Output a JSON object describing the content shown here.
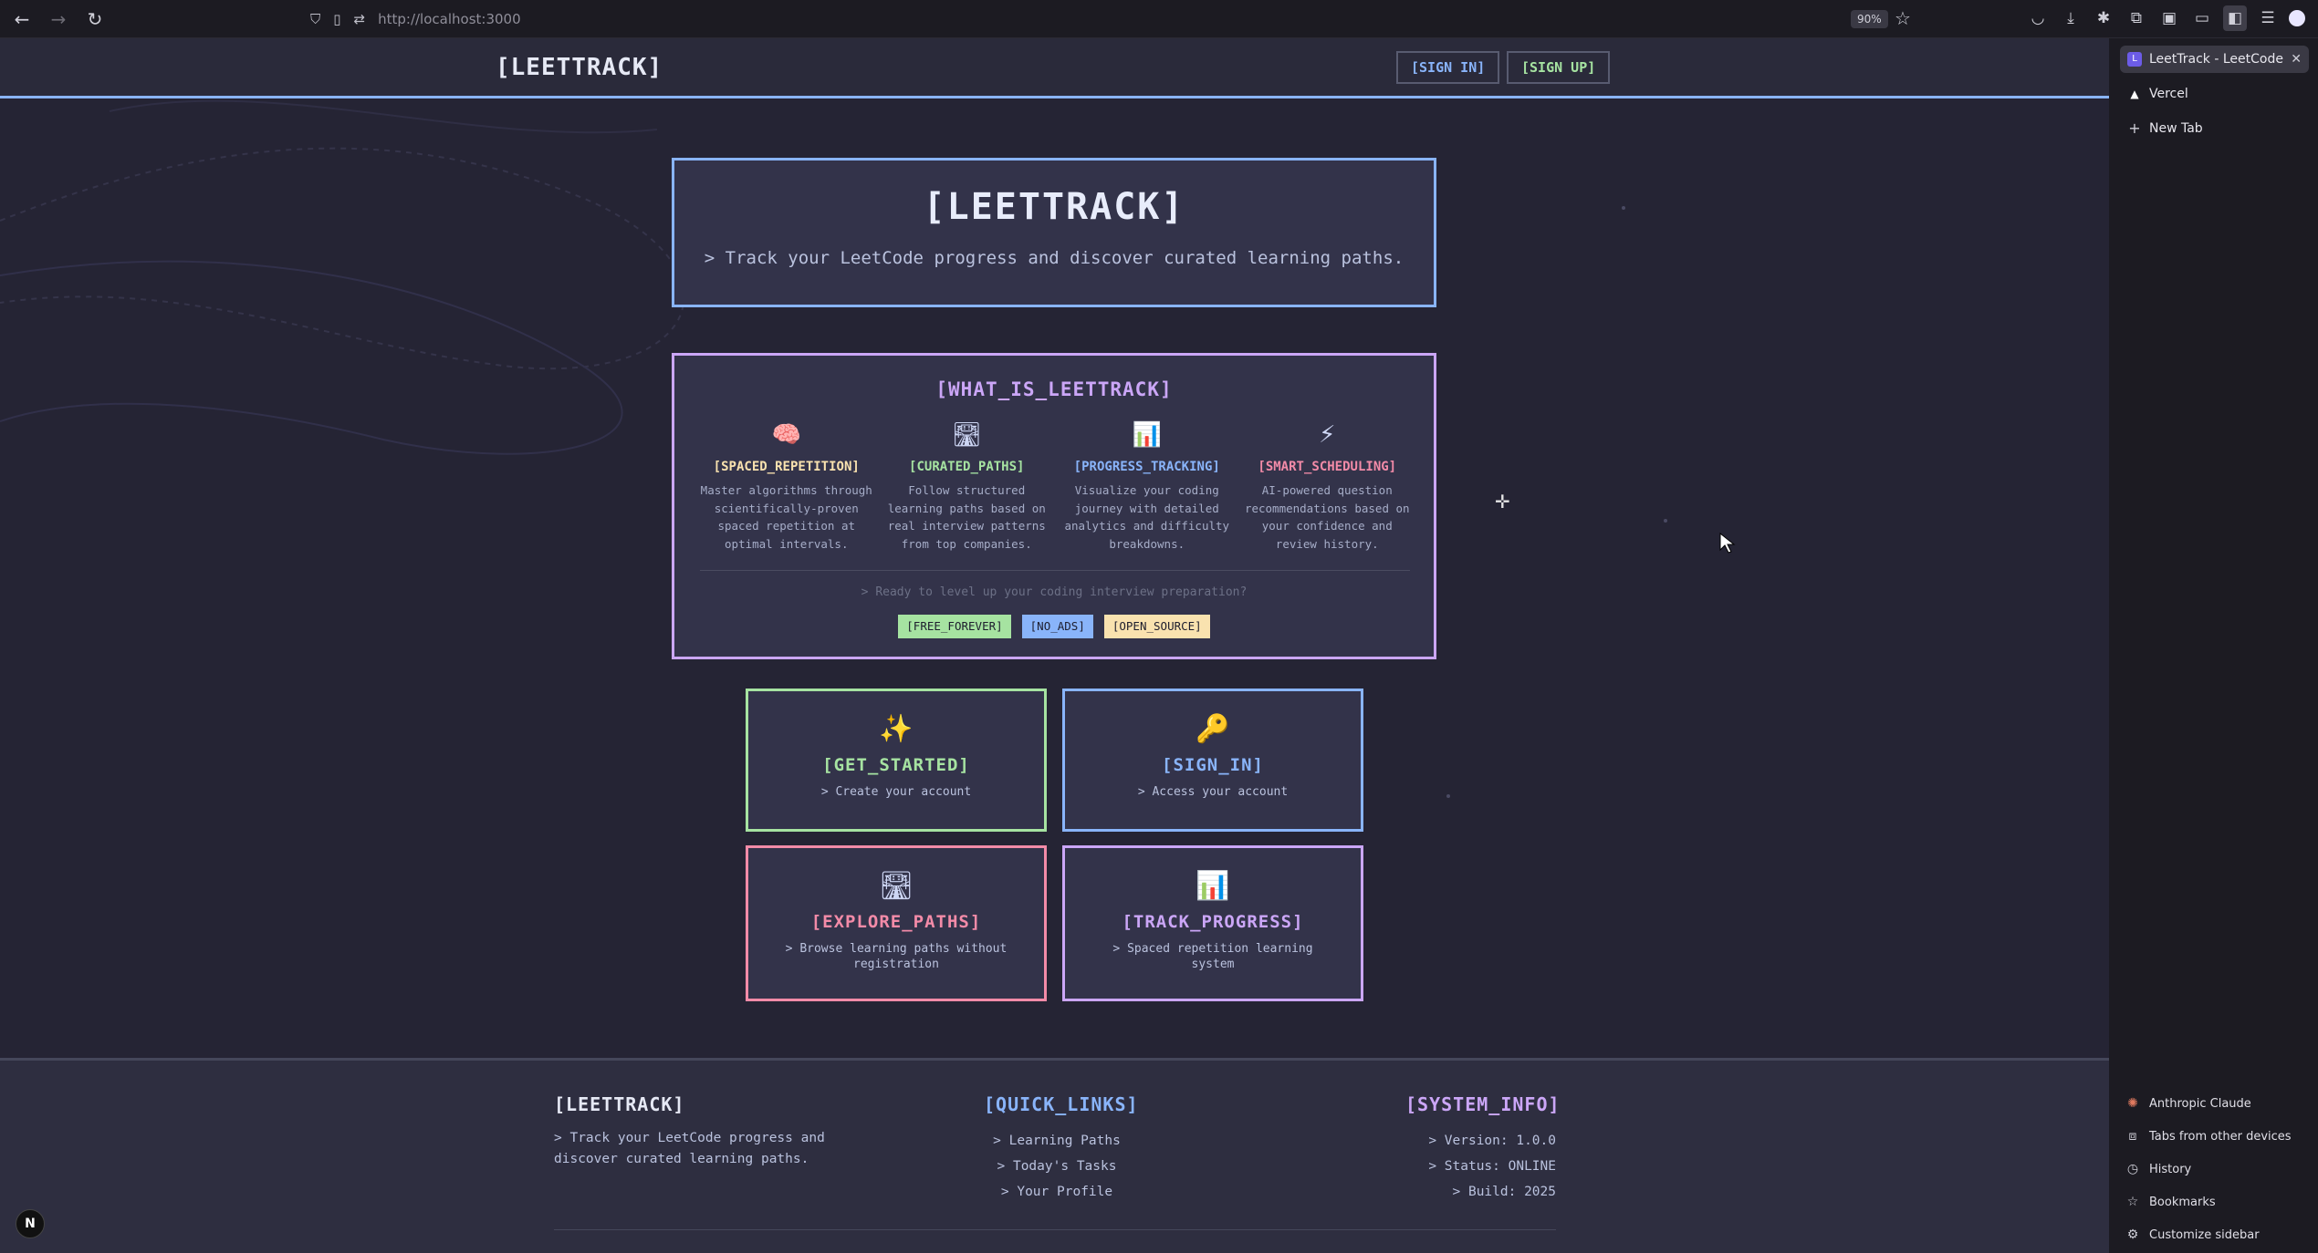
{
  "browser": {
    "url": "http://localhost:3000",
    "zoom": "90%",
    "icons": {
      "back": "back-arrow-icon",
      "forward": "forward-arrow-icon",
      "reload": "reload-icon",
      "bookmark": "star-icon"
    }
  },
  "sidebar": {
    "tabs": [
      {
        "label": "LeetTrack - LeetCode Le",
        "active": true
      },
      {
        "label": "Vercel",
        "active": false
      },
      {
        "label": "New Tab",
        "active": false
      }
    ],
    "bottom_items": [
      {
        "label": "Anthropic Claude",
        "icon": "claude-icon"
      },
      {
        "label": "Tabs from other devices",
        "icon": "devices-icon"
      },
      {
        "label": "History",
        "icon": "history-icon"
      },
      {
        "label": "Bookmarks",
        "icon": "star-icon"
      },
      {
        "label": "Customize sidebar",
        "icon": "gear-icon"
      }
    ]
  },
  "header": {
    "logo": "[LEETTRACK]",
    "sign_in": "[SIGN IN]",
    "sign_up": "[SIGN UP]"
  },
  "hero": {
    "title": "[LEETTRACK]",
    "subtitle": "> Track your LeetCode progress and discover curated learning paths."
  },
  "about": {
    "title": "[WHAT_IS_LEETTRACK]",
    "features": [
      {
        "icon": "🧠",
        "title": "[SPACED_REPETITION]",
        "description": "Master algorithms through scientifically-proven spaced repetition at optimal intervals."
      },
      {
        "icon": "🛣",
        "title": "[CURATED_PATHS]",
        "description": "Follow structured learning paths based on real interview patterns from top companies."
      },
      {
        "icon": "📊",
        "title": "[PROGRESS_TRACKING]",
        "description": "Visualize your coding journey with detailed analytics and difficulty breakdowns."
      },
      {
        "icon": "⚡",
        "title": "[SMART_SCHEDULING]",
        "description": "AI-powered question recommendations based on your confidence and review history."
      }
    ],
    "cta": "> Ready to level up your coding interview preparation?",
    "badges": [
      "[FREE_FOREVER]",
      "[NO_ADS]",
      "[OPEN_SOURCE]"
    ]
  },
  "cards": {
    "get_started": {
      "icon": "✨",
      "title": "[GET_STARTED]",
      "subtitle": "> Create your account"
    },
    "sign_in": {
      "icon": "🔑",
      "title": "[SIGN_IN]",
      "subtitle": "> Access your account"
    },
    "explore": {
      "icon": "🛣",
      "title": "[EXPLORE_PATHS]",
      "subtitle": "> Browse learning paths without registration"
    },
    "track": {
      "icon": "📊",
      "title": "[TRACK_PROGRESS]",
      "subtitle": "> Spaced repetition learning system"
    }
  },
  "footer": {
    "brand": "[LEETTRACK]",
    "brand_text": "> Track your LeetCode progress and discover curated learning paths.",
    "links_title": "[QUICK_LINKS]",
    "links": [
      "> Learning Paths",
      "> Today's Tasks",
      "> Your Profile"
    ],
    "system_title": "[SYSTEM_INFO]",
    "system": [
      "> Version: 1.0.0",
      "> Status: ONLINE",
      "> Build: 2025"
    ]
  },
  "next_badge": "N",
  "colors": {
    "blue": "#89b4fa",
    "purple": "#cba6f7",
    "green": "#a6e3a1",
    "pink": "#f38ba8",
    "yellow": "#f9e2af",
    "background": "#252434"
  }
}
